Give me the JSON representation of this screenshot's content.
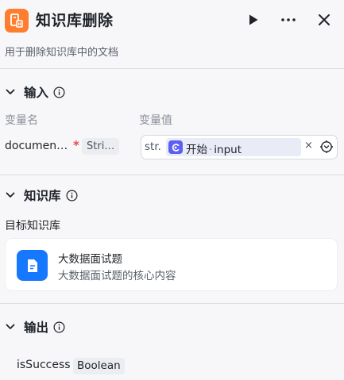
{
  "header": {
    "title": "知识库删除",
    "subtitle": "用于删除知识库中的文档",
    "accent_color": "#ff7d2e",
    "node_icon": "knowledge-delete-icon",
    "actions": [
      "run-icon",
      "more-icon",
      "close-icon"
    ]
  },
  "input_section": {
    "title": "输入",
    "col_name": "变量名",
    "col_value": "变量值",
    "var_name": "documen…",
    "required_mark": "*",
    "var_type": "Stri…",
    "value_prefix": "str.",
    "ref_node": "开始",
    "ref_sep": "·",
    "ref_var": "input",
    "clear_symbol": "×"
  },
  "knowledge_section": {
    "title": "知识库",
    "target_label": "目标知识库",
    "card": {
      "name": "大数据面试题",
      "description": "大数据面试题的核心内容"
    }
  },
  "output_section": {
    "title": "输出",
    "var_name": "isSuccess",
    "var_type": "Boolean"
  }
}
